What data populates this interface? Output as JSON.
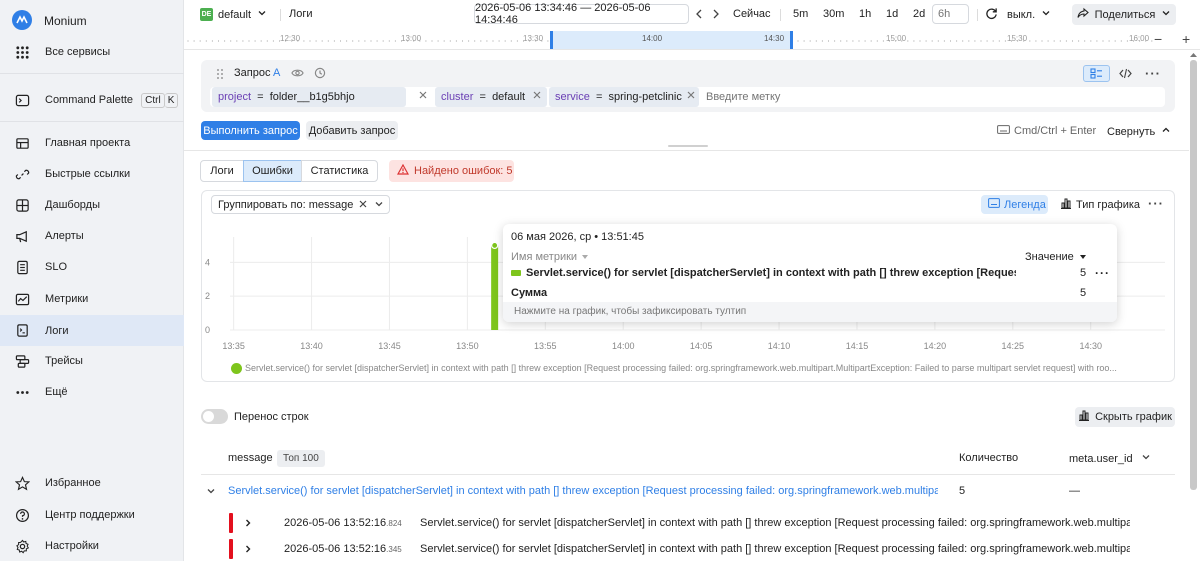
{
  "app": {
    "name": "Monium"
  },
  "sidebar": {
    "items": [
      {
        "label": "Все сервисы",
        "icon": "grid-icon"
      },
      {
        "label": "Command Palette",
        "icon": "terminal-icon",
        "shortcut_keys": [
          "Ctrl",
          "K"
        ]
      },
      {
        "label": "Главная проекта",
        "icon": "home-icon"
      },
      {
        "label": "Быстрые ссылки",
        "icon": "link-icon"
      },
      {
        "label": "Дашборды",
        "icon": "dashboard-icon"
      },
      {
        "label": "Алерты",
        "icon": "megaphone-icon"
      },
      {
        "label": "SLO",
        "icon": "slo-icon"
      },
      {
        "label": "Метрики",
        "icon": "chart-icon"
      },
      {
        "label": "Логи",
        "icon": "logs-icon",
        "active": true
      },
      {
        "label": "Трейсы",
        "icon": "traces-icon"
      },
      {
        "label": "Ещё",
        "icon": "more-icon"
      },
      {
        "label": "Избранное",
        "icon": "star-icon"
      },
      {
        "label": "Центр поддержки",
        "icon": "help-icon"
      },
      {
        "label": "Настройки",
        "icon": "gear-icon"
      }
    ]
  },
  "topbar": {
    "env_badge": "DE",
    "env_name": "default",
    "page_title": "Логи",
    "time_range": "2026-05-06 13:34:46 — 2026-05-06 14:34:46",
    "now_label": "Сейчас",
    "presets": [
      "5m",
      "30m",
      "1h",
      "1d",
      "2d"
    ],
    "custom_placeholder": "6h",
    "refresh_label": "выкл.",
    "share_label": "Поделиться"
  },
  "timeline": {
    "ticks": [
      "12:30",
      "13:00",
      "13:30",
      "14:00",
      "14:30",
      "15:00",
      "15:30",
      "16:00"
    ],
    "minus": "−",
    "plus": "+"
  },
  "query": {
    "title": "Запрос",
    "letter": "A",
    "tags": [
      {
        "key": "project",
        "value": "folder__b1g5bhjo"
      },
      {
        "key": "cluster",
        "value": "default"
      },
      {
        "key": "service",
        "value": "spring-petclinic"
      }
    ],
    "input_placeholder": "Введите метку",
    "run_label": "Выполнить запрос",
    "add_label": "Добавить запрос",
    "shortcut_hint": "Cmd/Ctrl + Enter",
    "collapse_label": "Свернуть"
  },
  "tabs": {
    "logs": "Логи",
    "errors": "Ошибки",
    "stats": "Статистика",
    "found": "Найдено ошибок: 5"
  },
  "chart_controls": {
    "group_label": "Группировать по:",
    "group_value": "message",
    "legend_label": "Легенда",
    "chart_type_label": "Тип графика"
  },
  "chart_data": {
    "type": "bar",
    "x": [
      "13:35",
      "13:40",
      "13:45",
      "13:50",
      "13:55",
      "14:00",
      "14:05",
      "14:10",
      "14:15",
      "14:20",
      "14:25",
      "14:30"
    ],
    "y_ticks": [
      "0",
      "2",
      "4"
    ],
    "ylim": [
      0,
      5.5
    ],
    "series": [
      {
        "name": "Servlet.service() for servlet [dispatcherServlet] in context with path [] threw exception [Request processing failed: org.springframework.web.multipart.MultipartException: Failed to parse multipart servlet request] with roo...",
        "color": "#7ec51c",
        "points": [
          {
            "x": "13:51:45",
            "y": 5
          }
        ]
      }
    ],
    "legend": "bottom"
  },
  "tooltip": {
    "date": "06 мая 2026, ср • 13:51:45",
    "metric_header": "Имя метрики",
    "value_header": "Значение",
    "row_label": "Servlet.service() for servlet [dispatcherServlet] in context with path [] threw exception [Request proces...",
    "row_value": "5",
    "sum_label": "Сумма",
    "sum_value": "5",
    "hint": "Нажмите на график, чтобы зафиксировать тултип"
  },
  "wrap_label": "Перенос строк",
  "hide_chart_label": "Скрыть график",
  "table": {
    "col_message": "message",
    "top_badge": "Топ 100",
    "col_count": "Количество",
    "col_user": "meta.user_id",
    "group_row": {
      "message": "Servlet.service() for servlet [dispatcherServlet] in context with path [] threw exception [Request processing failed: org.springframework.web.multipart.M...",
      "count": "5",
      "user": "—"
    },
    "rows": [
      {
        "ts": "2026-05-06 13:52:16",
        "ms": ".824",
        "message": "Servlet.service() for servlet [dispatcherServlet] in context with path [] threw exception [Request processing failed: org.springframework.web.multipart.Mul..."
      },
      {
        "ts": "2026-05-06 13:52:16",
        "ms": ".345",
        "message": "Servlet.service() for servlet [dispatcherServlet] in context with path [] threw exception [Request processing failed: org.springframework.web.multipart.Mul..."
      }
    ]
  }
}
